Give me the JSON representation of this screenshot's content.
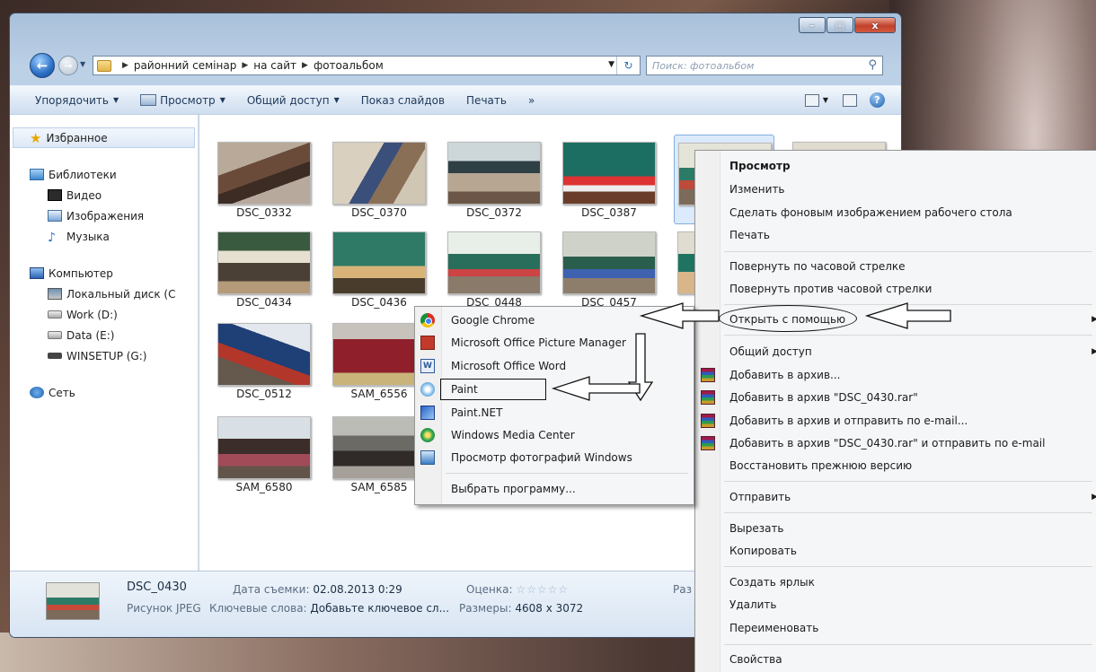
{
  "window": {
    "minimize": "–",
    "maximize": "□",
    "close": "x"
  },
  "address": {
    "crumbs": [
      "районний семінар",
      "на сайт",
      "фотоальбом"
    ],
    "search_placeholder": "Поиск: фотоальбом"
  },
  "toolbar": {
    "organize": "Упорядочить",
    "view": "Просмотр",
    "share": "Общий доступ",
    "slideshow": "Показ слайдов",
    "print": "Печать",
    "more": "»"
  },
  "nav": {
    "favorites": "Избранное",
    "libraries": "Библиотеки",
    "video": "Видео",
    "images": "Изображения",
    "music": "Музыка",
    "computer": "Компьютер",
    "local_disk": "Локальный диск (C",
    "work": "Work (D:)",
    "data": "Data (E:)",
    "winsetup": "WINSETUP (G:)",
    "network": "Сеть"
  },
  "files": [
    "DSC_0332",
    "DSC_0370",
    "DSC_0372",
    "DSC_0387",
    "DSC_0434",
    "DSC_0436",
    "DSC_0448",
    "DSC_0457",
    "DSC_0512",
    "SAM_6556",
    "SAM_6580",
    "SAM_6585"
  ],
  "details": {
    "name": "DSC_0430",
    "type": "Рисунок JPEG",
    "date_label": "Дата съемки:",
    "date_value": "02.08.2013 0:29",
    "rating_label": "Оценка:",
    "rating_stars": "☆☆☆☆☆",
    "keywords_label": "Ключевые слова:",
    "keywords_value": "Добавьте ключевое сл...",
    "size_label": "Размеры:",
    "size_value": "4608 x 3072",
    "cut_label": "Раз"
  },
  "context_menu": {
    "preview": "Просмотр",
    "edit": "Изменить",
    "set_wallpaper": "Сделать фоновым изображением рабочего стола",
    "print": "Печать",
    "rotate_cw": "Повернуть по часовой стрелке",
    "rotate_ccw": "Повернуть против часовой стрелки",
    "open_with": "Открыть с помощью",
    "share": "Общий доступ",
    "add_archive": "Добавить в архив...",
    "add_rar": "Добавить в архив \"DSC_0430.rar\"",
    "add_email": "Добавить в архив и отправить по e-mail...",
    "add_rar_email": "Добавить в архив \"DSC_0430.rar\" и отправить по e-mail",
    "restore": "Восстановить прежнюю версию",
    "send_to": "Отправить",
    "cut": "Вырезать",
    "copy": "Копировать",
    "shortcut": "Создать ярлык",
    "delete": "Удалить",
    "rename": "Переименовать",
    "properties": "Свойства"
  },
  "open_with_menu": {
    "chrome": "Google Chrome",
    "picture_manager": "Microsoft Office Picture Manager",
    "word": "Microsoft Office Word",
    "paint": "Paint",
    "paint_net": "Paint.NET",
    "media_center": "Windows Media Center",
    "photo_viewer": "Просмотр фотографий Windows",
    "choose": "Выбрать программу..."
  }
}
